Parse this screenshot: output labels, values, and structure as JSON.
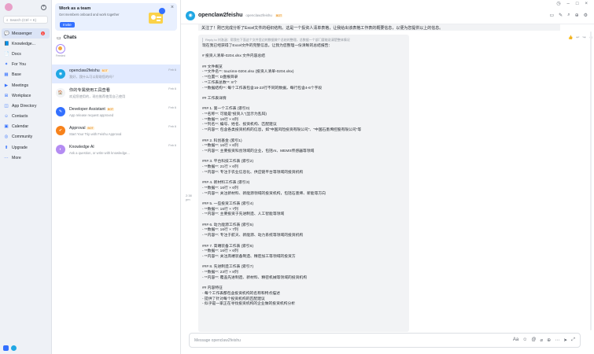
{
  "nav": {
    "search_placeholder": "Search (Ctrl + K)",
    "items": [
      {
        "label": "Messenger",
        "icon": "chat-bubble-icon",
        "glyph": "💬",
        "badge": "1",
        "active": true
      },
      {
        "label": "Knowledge...",
        "icon": "book-icon",
        "glyph": "📘",
        "badge": "",
        "active": false
      },
      {
        "label": "Docs",
        "icon": "doc-icon",
        "glyph": "📄",
        "badge": "",
        "active": false
      },
      {
        "label": "For You",
        "icon": "star-icon",
        "glyph": "✦",
        "badge": "",
        "active": false
      },
      {
        "label": "Base",
        "icon": "grid-icon",
        "glyph": "▦",
        "badge": "",
        "active": false
      },
      {
        "label": "Meetings",
        "icon": "video-icon",
        "glyph": "▶",
        "badge": "",
        "active": false
      },
      {
        "label": "Workplace",
        "icon": "apps-icon",
        "glyph": "⊞",
        "badge": "",
        "active": false
      },
      {
        "label": "App Directory",
        "icon": "store-icon",
        "glyph": "◫",
        "badge": "",
        "active": false
      },
      {
        "label": "Contacts",
        "icon": "contacts-icon",
        "glyph": "☺",
        "badge": "",
        "active": false
      },
      {
        "label": "Calendar",
        "icon": "calendar-icon",
        "glyph": "▣",
        "badge": "",
        "active": false
      },
      {
        "label": "Community",
        "icon": "community-icon",
        "glyph": "◎",
        "badge": "",
        "active": false
      },
      {
        "label": "Upgrade",
        "icon": "upgrade-icon",
        "glyph": "⬆",
        "badge": "",
        "active": false
      },
      {
        "label": "More",
        "icon": "more-icon",
        "glyph": "⋯",
        "badge": "",
        "active": false
      }
    ]
  },
  "team": {
    "title": "Work as a team",
    "subtitle": "Get members onboard and work together",
    "button": "Invite"
  },
  "chats": {
    "title": "Chats",
    "story_label": "Feeded",
    "list": [
      {
        "name": "openclaw2feishu",
        "bot": "BOT",
        "preview": "我好，我什么可以帮助您的吗？",
        "date": "Feb 6",
        "color": "#20a7e4",
        "glyph": "◉",
        "active": true
      },
      {
        "name": "你的专属使用工具查看",
        "bot": "",
        "preview": "欢迎您使用的，现在推荐使用自己使用",
        "date": "Feb 6",
        "color": "#f2f3f5",
        "glyph": "🏠",
        "active": false
      },
      {
        "name": "Developer Assistant",
        "bot": "BOT",
        "preview": "App release request approved",
        "date": "Feb 6",
        "color": "#3370ff",
        "glyph": "✎",
        "active": false
      },
      {
        "name": "Approval",
        "bot": "BOT",
        "preview": "Start Your Trip with Feishu Approval",
        "date": "Feb 6",
        "color": "#f7821b",
        "glyph": "✔",
        "active": false
      },
      {
        "name": "Knowledge AI",
        "bot": "",
        "preview": "Ask a question, or write with knowledge...",
        "date": "Feb 6",
        "color": "#b48cf2",
        "glyph": "◐",
        "active": false
      }
    ]
  },
  "conv": {
    "name": "openclaw2feishu",
    "subtitle": "openclaw2feishu",
    "bot": "BOT",
    "top_message": "关注了！刚已完成分析了Excel文件的组织结构。这是一个投资人清单表格，让我给出该表格工作表的概要信息，以便为您提供以上的信息。",
    "time": "2:38 pm",
    "reply_quote": "Reply to 刘洛涵：帮我在下面这个文件里边的数据做个总结的整理，总数据一个部门要能说清楚整体情况",
    "lines": [
      "现在我已经获得了Excel文件的完整信息。让我为您整理一份清晰的总结报告：",
      "",
      "# 投资人清单-0204.xlsx 文件内容总结",
      "",
      "## 文件概览",
      "- **文件名**: touzimn-0204.xlsx (投资人清单-0204.xlsx)",
      "- **位置**: D盘根目录",
      "- **工作表总数**: 8个",
      "- **数据结构**: 每个工作表包含16-23行不同的数据，每行包含4-6个字段",
      "",
      "## 工作表详情",
      "",
      "### 1. 第一个工作表 (索引0)",
      "- **名称**: 可能是\"投资人\"(显示为乱码)",
      "- **数据**: 16行 × 6列",
      "- **列名**: 编号、姓名、投资机构、匹配建议",
      "- **内容**: 包含各类投资机构的信息，如\"中国风险投资有限公司\"、\"中国石墨烯控股有限公司\"等",
      "",
      "### 2. 科创基金 (索引1)",
      "- **数据**: 16行 × 6列",
      "- **内容**: 主要投资科创领域的企业，包括AI、MEMS传感器等领域",
      "",
      "### 3. 平台科技工作表 (索引2)",
      "- **数据**: 21行 × 6列",
      "- **内容**: 专注于农业信息化、供应链平台等领域的投资机构",
      "",
      "### 4. 新材料工作表 (索引3)",
      "- **数据**: 16行 × 6列",
      "- **内容**: 关注新材料、新能源领域的投资机构，包括石墨烯、新能等方向",
      "",
      "### 5. 一些投资工作表 (索引4)",
      "- **数据**: 16行 × 7列",
      "- **内容**: 主要投资于先进制造、人工智能等领域",
      "",
      "### 6. 动力能源工作表 (索引5)",
      "- **数据**: 16行 × 7列",
      "- **内容**: 专注于航天、新能源、动力系统等领域的投资机构",
      "",
      "### 7. 高端装备工作表 (索引6)",
      "- **数据**: 16行 × 6列",
      "- **内容**: 关注高端装备制造、精密加工等领域的投资方",
      "",
      "### 8. 先进制造工作表 (索引7)",
      "- **数据**: 23行 × 8列",
      "- **内容**: 覆盖先进制造、新材料、精密机械等领域的投资机构",
      "",
      "## 内容特征",
      "- 每个工作表都包含投资机构的名称和特点描述",
      "- 提供了针对每个投资机构的匹配建议",
      "- 似乎是一家正在寻找投资机构的企业做的投资机构分析"
    ],
    "composer_placeholder": "Message openclaw2feishu"
  }
}
